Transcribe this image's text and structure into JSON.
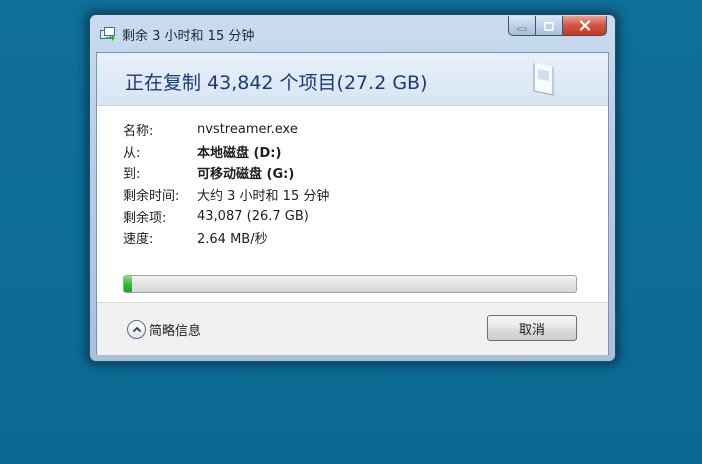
{
  "window": {
    "title": "剩余 3 小时和 15 分钟"
  },
  "header": {
    "title": "正在复制 43,842 个项目(27.2 GB)"
  },
  "details": [
    {
      "label": "名称:",
      "value": "nvstreamer.exe",
      "bold": false
    },
    {
      "label": "从:",
      "value": "本地磁盘 (D:)",
      "bold": true
    },
    {
      "label": "到:",
      "value": "可移动磁盘 (G:)",
      "bold": true
    },
    {
      "label": "剩余时间:",
      "value": "大约 3 小时和 15 分钟",
      "bold": false
    },
    {
      "label": "剩余项:",
      "value": "43,087 (26.7 GB)",
      "bold": false
    },
    {
      "label": "速度:",
      "value": "2.64 MB/秒",
      "bold": false
    }
  ],
  "progress": {
    "fraction": 0.017
  },
  "footer": {
    "more_info_label": "简略信息",
    "cancel_label": "取消"
  },
  "colors": {
    "desktop": "#0f7098",
    "header_text": "#1b3a78",
    "progress_fill": "#2fbf35",
    "close_button": "#c13a22"
  },
  "icons": {
    "app": "copy-window-icon",
    "minimize": "minimize-icon",
    "maximize": "maximize-icon",
    "close": "close-icon",
    "document": "document-icon",
    "chevron": "chevron-up-icon"
  }
}
